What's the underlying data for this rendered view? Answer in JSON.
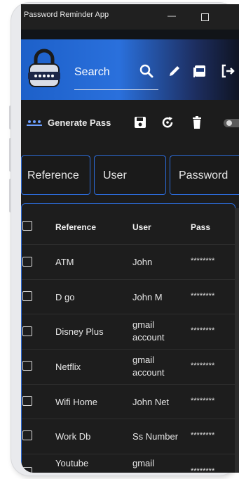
{
  "window": {
    "title": "Password Reminder App",
    "minimize_symbol": "—"
  },
  "header": {
    "search_label": "Search",
    "icons": [
      "search-icon",
      "edit-icon",
      "pdf-icon",
      "logout-icon"
    ]
  },
  "toolbar": {
    "generate_label": "Generate Pass",
    "icons": [
      "save-icon",
      "refresh-icon",
      "delete-icon"
    ],
    "toggle_on": false
  },
  "fields": {
    "reference": "Reference",
    "user": "User",
    "password": "Password"
  },
  "table": {
    "columns": [
      "Reference",
      "User",
      "Pass"
    ],
    "rows": [
      {
        "reference": "ATM",
        "user_lines": [
          "John"
        ],
        "pass": "********"
      },
      {
        "reference": "D go",
        "user_lines": [
          "John M"
        ],
        "pass": "********"
      },
      {
        "reference": "Disney Plus",
        "user_lines": [
          "gmail",
          "account"
        ],
        "pass": "********"
      },
      {
        "reference": "Netflix",
        "user_lines": [
          "gmail",
          "account"
        ],
        "pass": "********"
      },
      {
        "reference": "Wifi Home",
        "user_lines": [
          "John Net"
        ],
        "pass": "********"
      },
      {
        "reference": "Work Db",
        "user_lines": [
          "Ss Number"
        ],
        "pass": "********"
      },
      {
        "reference": "Youtube",
        "user_lines": [
          "gmail"
        ],
        "pass": "********"
      }
    ]
  },
  "colors": {
    "accent": "#2c6bd8",
    "background": "#1c1c1c",
    "text": "#e6e6e6"
  }
}
